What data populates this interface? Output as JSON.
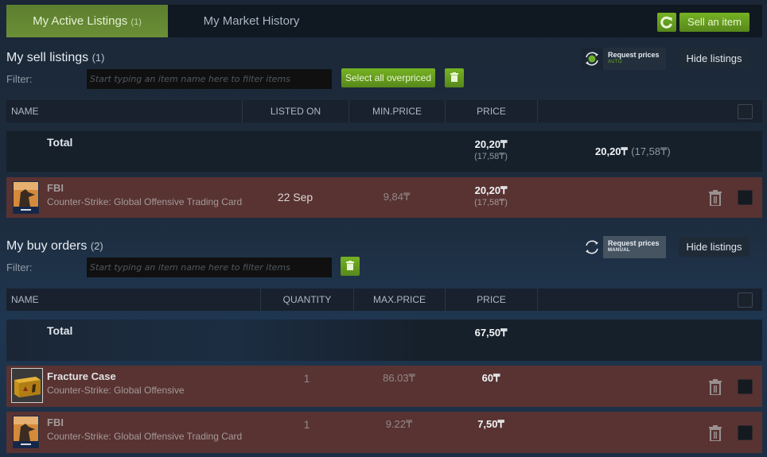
{
  "tabs": {
    "active": {
      "label": "My Active Listings",
      "count": "(1)"
    },
    "history": {
      "label": "My Market History"
    }
  },
  "toolbar": {
    "sell_label": "Sell an item",
    "refresh_icon": "refresh-icon"
  },
  "sell_section": {
    "title": "My sell listings",
    "count": "(1)",
    "filter_label": "Filter:",
    "filter_placeholder": "Start typing an item name here to filter items",
    "select_overpriced_label": "Select all overpriced",
    "request_prices": {
      "title": "Request prices",
      "mode": "AUTO"
    },
    "hide_label": "Hide listings",
    "columns": [
      "NAME",
      "LISTED ON",
      "MIN.PRICE",
      "PRICE"
    ],
    "total": {
      "label": "Total",
      "price": "20,20₸",
      "price_sub": "(17,58₸)",
      "grand": "20,20₸",
      "grand_sub": "(17,58₸)"
    },
    "rows": [
      {
        "name": "FBI",
        "game": "Counter-Strike: Global Offensive Trading Card",
        "listed_on": "22 Sep",
        "min_price": "9,84₸",
        "price": "20,20₸",
        "price_sub": "(17,58₸)"
      }
    ]
  },
  "buy_section": {
    "title": "My buy orders",
    "count": "(2)",
    "filter_label": "Filter:",
    "filter_placeholder": "Start typing an item name here to filter items",
    "request_prices": {
      "title": "Request prices",
      "mode": "MANUAL"
    },
    "hide_label": "Hide listings",
    "columns": [
      "NAME",
      "QUANTITY",
      "MAX.PRICE",
      "PRICE"
    ],
    "total": {
      "label": "Total",
      "price": "67,50₸"
    },
    "rows": [
      {
        "name": "Fracture Case",
        "game": "Counter-Strike: Global Offensive",
        "quantity": "1",
        "max_price": "86.03₸",
        "price": "60₸"
      },
      {
        "name": "FBI",
        "game": "Counter-Strike: Global Offensive Trading Card",
        "quantity": "1",
        "max_price": "9.22₸",
        "price": "7,50₸"
      }
    ]
  },
  "colors": {
    "accent_green": "#75b022",
    "row_overpriced": "#583332",
    "auto_green": "#6fae29"
  }
}
